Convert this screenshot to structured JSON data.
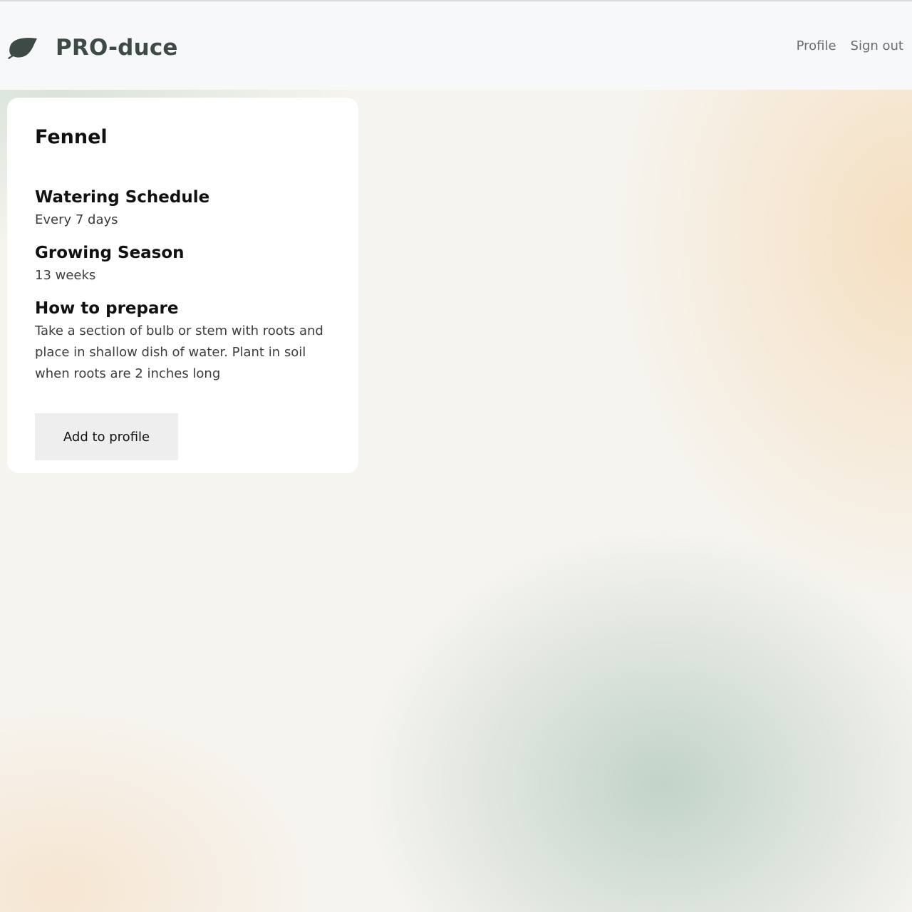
{
  "app": {
    "brand_name": "PRO-duce",
    "logo_icon": "leaf-icon",
    "logo_color": "#3d4a45"
  },
  "nav": {
    "profile_label": "Profile",
    "signout_label": "Sign out"
  },
  "plant": {
    "name": "Fennel",
    "sections": [
      {
        "heading": "Watering Schedule",
        "value": "Every 7 days"
      },
      {
        "heading": "Growing Season",
        "value": "13 weeks"
      },
      {
        "heading": "How to prepare",
        "value": "Take a section of bulb or stem with roots and place in shallow dish of water. Plant in soil when roots are 2 inches long"
      }
    ],
    "add_button_label": "Add to profile"
  }
}
